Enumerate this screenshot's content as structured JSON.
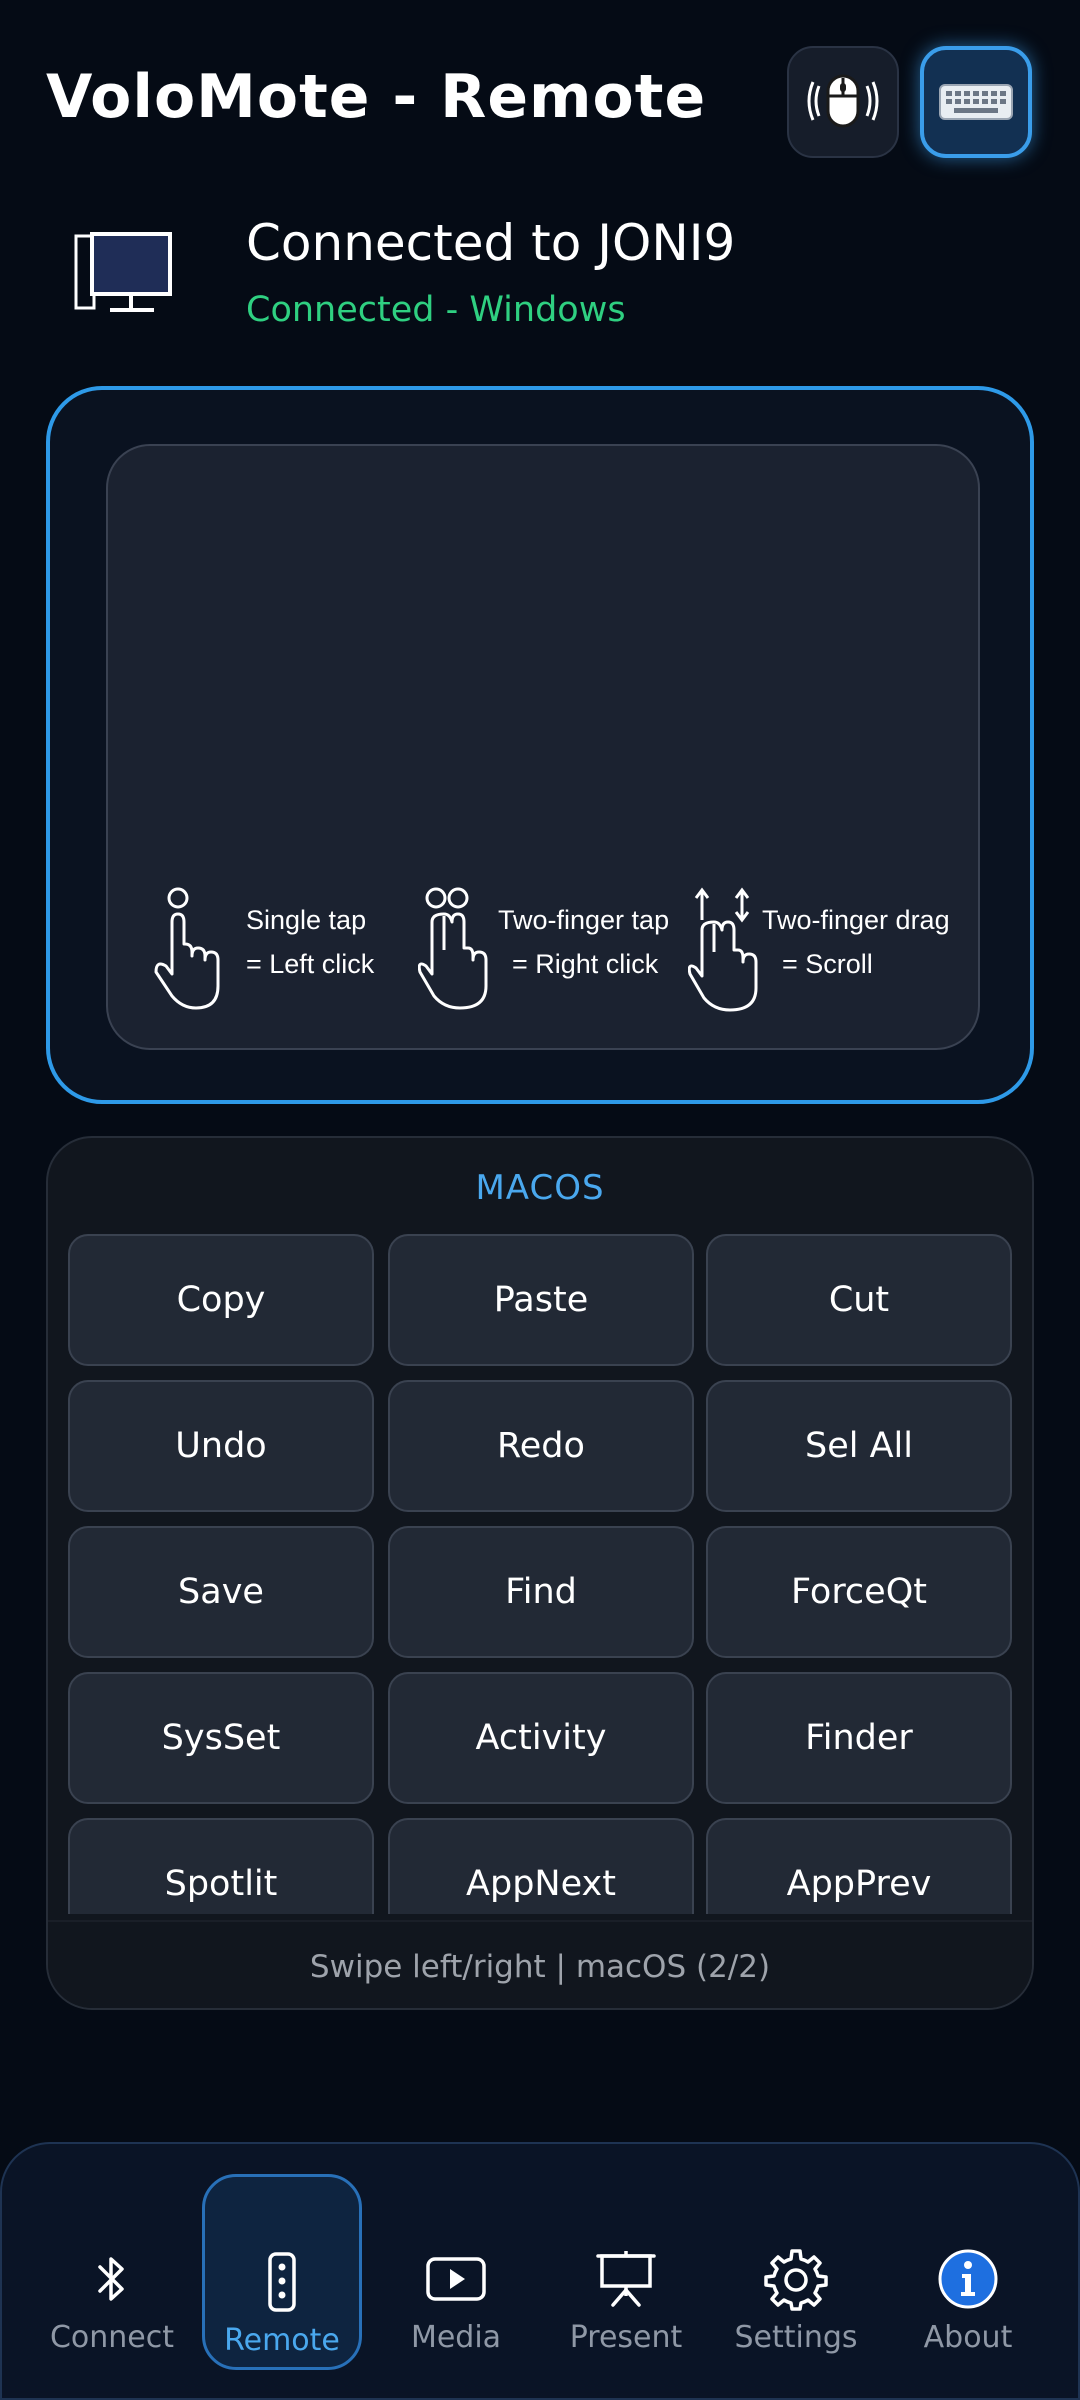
{
  "header": {
    "title": "VoloMote - Remote",
    "mouse_mode_icon": "mouse-icon",
    "keyboard_mode_icon": "keyboard-icon"
  },
  "status": {
    "title": "Connected to JONI9",
    "subtitle": "Connected - Windows",
    "subtitle_color": "#2fd081"
  },
  "touchpad": {
    "hints": [
      {
        "icon": "single-tap-icon",
        "line1": "Single tap",
        "line2": "= Left click"
      },
      {
        "icon": "two-finger-tap-icon",
        "line1": "Two-finger tap",
        "line2": "= Right click"
      },
      {
        "icon": "two-finger-drag-icon",
        "line1": "Two-finger drag",
        "line2": "= Scroll"
      }
    ]
  },
  "macros": {
    "title": "MACOS",
    "buttons": [
      "Copy",
      "Paste",
      "Cut",
      "Undo",
      "Redo",
      "Sel All",
      "Save",
      "Find",
      "ForceQt",
      "SysSet",
      "Activity",
      "Finder",
      "Spotlit",
      "AppNext",
      "AppPrev"
    ],
    "footer": "Swipe left/right  |  macOS (2/2)"
  },
  "nav": {
    "items": [
      {
        "label": "Connect",
        "icon": "bluetooth-icon",
        "active": false
      },
      {
        "label": "Remote",
        "icon": "remote-icon",
        "active": true
      },
      {
        "label": "Media",
        "icon": "play-icon",
        "active": false
      },
      {
        "label": "Present",
        "icon": "presentation-icon",
        "active": false
      },
      {
        "label": "Settings",
        "icon": "gear-icon",
        "active": false
      },
      {
        "label": "About",
        "icon": "info-icon",
        "active": false
      }
    ]
  },
  "colors": {
    "accent": "#3a9dea",
    "background": "#050b15",
    "connected": "#2fd081"
  }
}
